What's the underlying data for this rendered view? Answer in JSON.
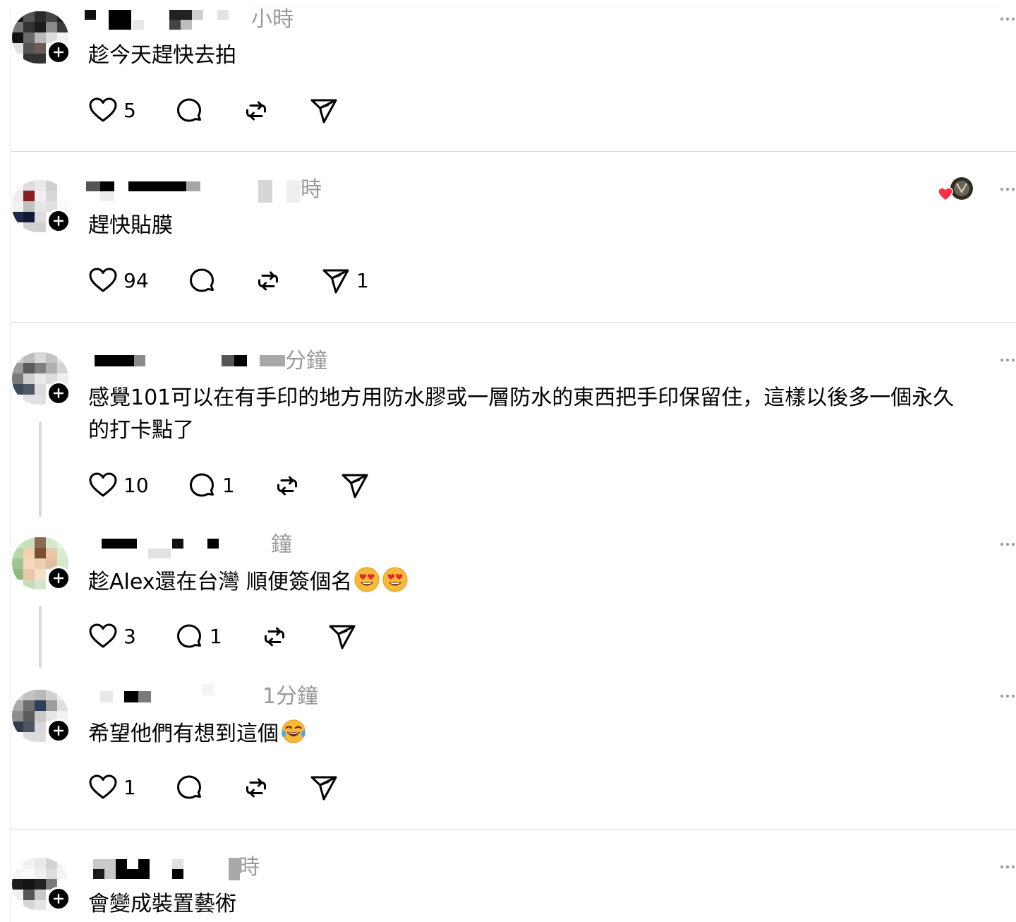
{
  "colors": {
    "text": "#000000",
    "muted": "#999999",
    "divider": "#d9d9d9",
    "heart_red": "#ff3040"
  },
  "posts": [
    {
      "timestamp": "小時",
      "body": [
        "趁今天趕快去拍"
      ],
      "likes": "5",
      "replies": "",
      "reposts": "",
      "shares": ""
    },
    {
      "timestamp": "時",
      "body": [
        "趕快貼膜"
      ],
      "likes": "94",
      "replies": "",
      "reposts": "",
      "shares": "1",
      "author_liked_icon": "author-liked-heart-icon"
    },
    {
      "timestamp": "分鐘",
      "body": [
        "感覺101可以在有手印的地方用防水膠或一層防水的東西把手印保留住，這樣以後多一個永久",
        "的打卡點了"
      ],
      "likes": "10",
      "replies": "1",
      "reposts": "",
      "shares": ""
    },
    {
      "timestamp": "鐘",
      "body": [
        "趁Alex還在台灣 順便簽個名"
      ],
      "emojis": [
        "heart-eyes-emoji",
        "heart-eyes-emoji"
      ],
      "likes": "3",
      "replies": "1",
      "reposts": "",
      "shares": ""
    },
    {
      "timestamp": "1分鐘",
      "body": [
        "希望他們有想到這個"
      ],
      "emojis": [
        "tears-of-joy-emoji"
      ],
      "likes": "1",
      "replies": "",
      "reposts": "",
      "shares": ""
    },
    {
      "timestamp": "時",
      "body": [
        "會變成裝置藝術"
      ],
      "likes": "",
      "replies": "",
      "reposts": "",
      "shares": ""
    }
  ],
  "icons": {
    "like": "heart-outline-icon",
    "reply": "comment-bubble-icon",
    "repost": "repost-arrows-icon",
    "share": "paper-plane-icon",
    "more": "more-dots-icon",
    "follow": "plus-icon"
  }
}
